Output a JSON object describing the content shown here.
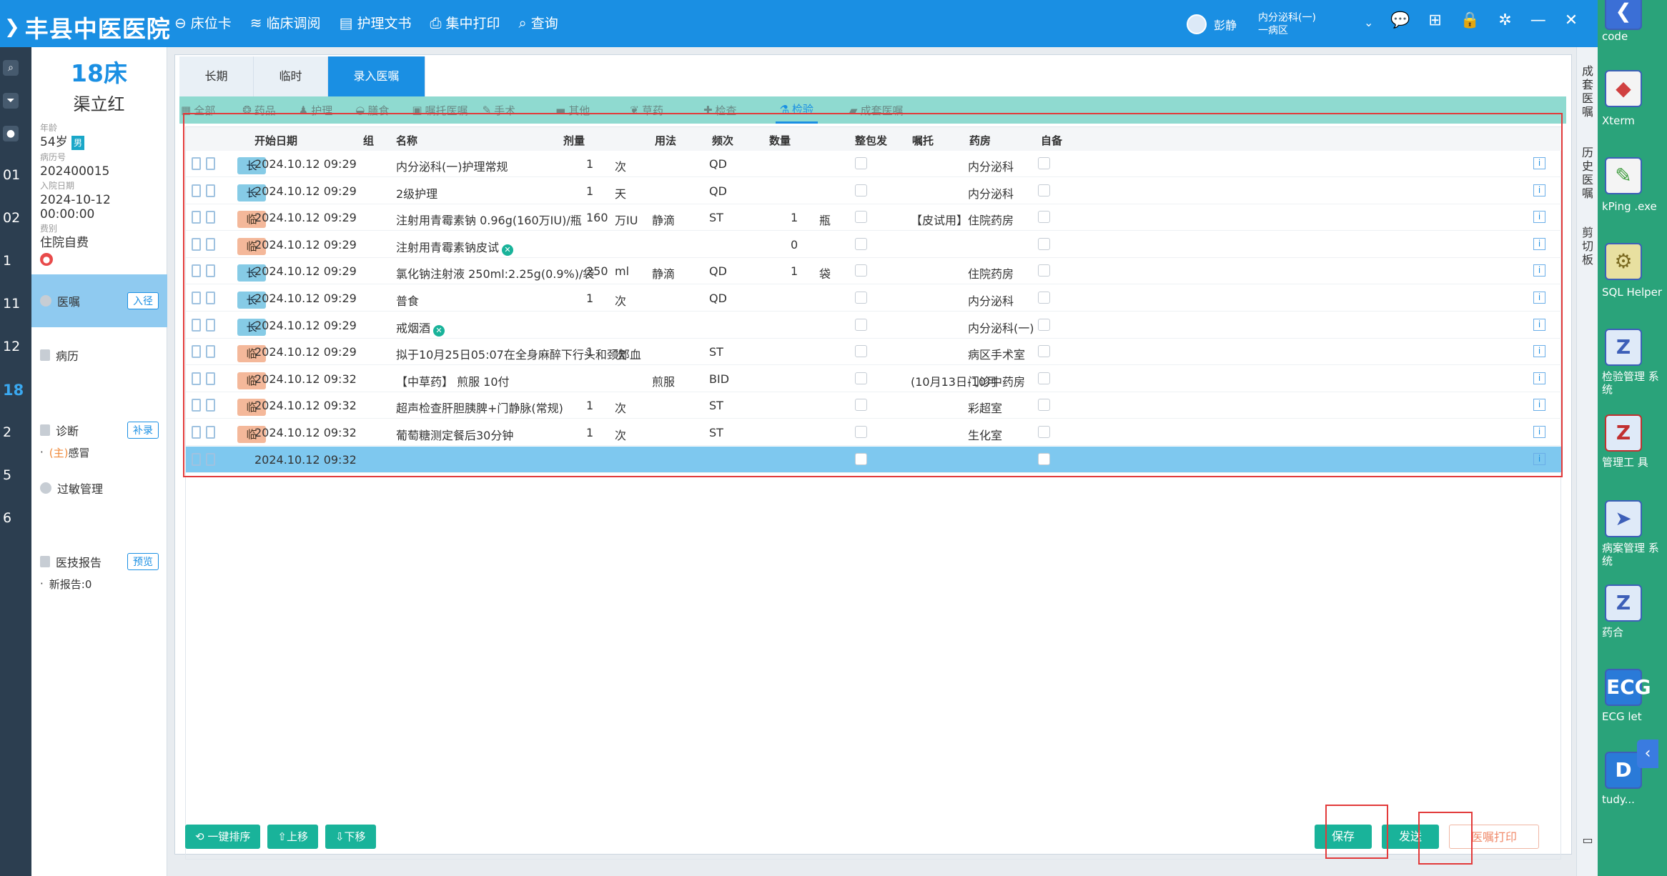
{
  "app": {
    "title": "丰县中医医院",
    "nav": [
      "床位卡",
      "临床调阅",
      "护理文书",
      "集中打印",
      "查询"
    ],
    "user_name": "彭静",
    "dept_line1": "内分泌科(一)",
    "dept_line2": "一病区"
  },
  "left_bar": [
    "01",
    "02",
    "1",
    "11",
    "12",
    "18",
    "2",
    "5",
    "6"
  ],
  "patient": {
    "bed": "18床",
    "name": "渠立红",
    "age_label": "年龄",
    "age": "54岁",
    "gender_badge": "男",
    "record_no_label": "病历号",
    "record_no": "202400015",
    "admit_label": "入院日期",
    "admit_date": "2024-10-12 00:00:00",
    "fee_label": "费别",
    "fee_type": "住院自费"
  },
  "patient_menu": {
    "orders": "医嘱",
    "orders_btn": "入径",
    "records": "病历",
    "diagnosis": "诊断",
    "diagnosis_btn": "补录",
    "diagnosis_main_prefix": "(主)",
    "diagnosis_main": "感冒",
    "allergy": "过敏管理",
    "reports": "医技报告",
    "reports_btn": "预览",
    "new_reports": "新报告:0"
  },
  "tabs": [
    "长期",
    "临时",
    "录入医嘱"
  ],
  "categories": [
    "全部",
    "药品",
    "护理",
    "膳食",
    "嘱托医嘱",
    "手术",
    "其他",
    "草药",
    "检查",
    "检验",
    "成套医嘱"
  ],
  "columns": [
    "开始日期",
    "组",
    "名称",
    "剂量",
    "用法",
    "频次",
    "数量",
    "整包发",
    "嘱托",
    "药房",
    "自备"
  ],
  "rows": [
    {
      "type": "长",
      "date": "2024.10.12 09:29",
      "name": "内分泌科(一)护理常规",
      "dose": "1",
      "unit": "次",
      "usage": "",
      "freq": "QD",
      "qty": "",
      "qunit": "",
      "note": "",
      "pharmacy": "内分泌科",
      "mark": false
    },
    {
      "type": "长",
      "date": "2024.10.12 09:29",
      "name": "2级护理",
      "dose": "1",
      "unit": "天",
      "usage": "",
      "freq": "QD",
      "qty": "",
      "qunit": "",
      "note": "",
      "pharmacy": "内分泌科",
      "mark": false
    },
    {
      "type": "临",
      "date": "2024.10.12 09:29",
      "name": "注射用青霉素钠 0.96g(160万IU)/瓶",
      "dose": "160",
      "unit": "万IU",
      "usage": "静滴",
      "freq": "ST",
      "qty": "1",
      "qunit": "瓶",
      "note": "【皮试用】",
      "pharmacy": "住院药房",
      "mark": false
    },
    {
      "type": "临",
      "date": "2024.10.12 09:29",
      "name": "注射用青霉素钠皮试",
      "dose": "",
      "unit": "",
      "usage": "",
      "freq": "",
      "qty": "0",
      "qunit": "",
      "note": "",
      "pharmacy": "",
      "mark": true
    },
    {
      "type": "长",
      "date": "2024.10.12 09:29",
      "name": "氯化钠注射液 250ml:2.25g(0.9%)/袋",
      "dose": "250",
      "unit": "ml",
      "usage": "静滴",
      "freq": "QD",
      "qty": "1",
      "qunit": "袋",
      "note": "",
      "pharmacy": "住院药房",
      "mark": false
    },
    {
      "type": "长",
      "date": "2024.10.12 09:29",
      "name": "普食",
      "dose": "1",
      "unit": "次",
      "usage": "",
      "freq": "QD",
      "qty": "",
      "qunit": "",
      "note": "",
      "pharmacy": "内分泌科",
      "mark": false
    },
    {
      "type": "长",
      "date": "2024.10.12 09:29",
      "name": "戒烟酒",
      "dose": "",
      "unit": "",
      "usage": "",
      "freq": "",
      "qty": "",
      "qunit": "",
      "note": "",
      "pharmacy": "内分泌科(一)",
      "mark": true
    },
    {
      "type": "临",
      "date": "2024.10.12 09:29",
      "name": "拟于10月25日05:07在全身麻醉下行头和颈部血",
      "dose": "1",
      "unit": "次",
      "usage": "",
      "freq": "ST",
      "qty": "",
      "qunit": "",
      "note": "",
      "pharmacy": "病区手术室",
      "mark": false
    },
    {
      "type": "临",
      "date": "2024.10.12 09:32",
      "name": "【中草药】 煎服 10付",
      "dose": "",
      "unit": "",
      "usage": "煎服",
      "freq": "BID",
      "qty": "",
      "qunit": "",
      "note": "(10月13日-10月",
      "pharmacy": "门诊中药房",
      "mark": false
    },
    {
      "type": "临",
      "date": "2024.10.12 09:32",
      "name": "超声检查肝胆胰脾+门静脉(常规)",
      "dose": "1",
      "unit": "次",
      "usage": "",
      "freq": "ST",
      "qty": "",
      "qunit": "",
      "note": "",
      "pharmacy": "彩超室",
      "mark": false
    },
    {
      "type": "临",
      "date": "2024.10.12 09:32",
      "name": "葡萄糖测定餐后30分钟",
      "dose": "1",
      "unit": "次",
      "usage": "",
      "freq": "ST",
      "qty": "",
      "qunit": "",
      "note": "",
      "pharmacy": "生化室",
      "mark": false
    },
    {
      "type": "",
      "date": "2024.10.12 09:32",
      "name": "",
      "dose": "",
      "unit": "",
      "usage": "",
      "freq": "",
      "qty": "",
      "qunit": "",
      "note": "",
      "pharmacy": "",
      "mark": false
    }
  ],
  "bottom_buttons": [
    "一键排序",
    "上移",
    "下移"
  ],
  "action_buttons": {
    "save": "保存",
    "send": "发送",
    "print": "医嘱打印"
  },
  "right_side": {
    "history_short": "成套医嘱",
    "history": "历史医嘱",
    "clipboard": "剪切板"
  },
  "desktop_icons": [
    "code",
    "Xterm",
    "kPing .exe",
    "SQL Helper",
    "检验管理 系统",
    "管理工 具",
    "病案管理 系统",
    "药合",
    "ECG let",
    "tudy..."
  ],
  "colors": {
    "brand": "#1a8fe3",
    "long_tag": "#86cbe6",
    "temp_tag": "#f4b89a",
    "green_btn": "#19b39a",
    "selected_row": "#7ec8ef",
    "highlight_box": "#e23a3a"
  }
}
